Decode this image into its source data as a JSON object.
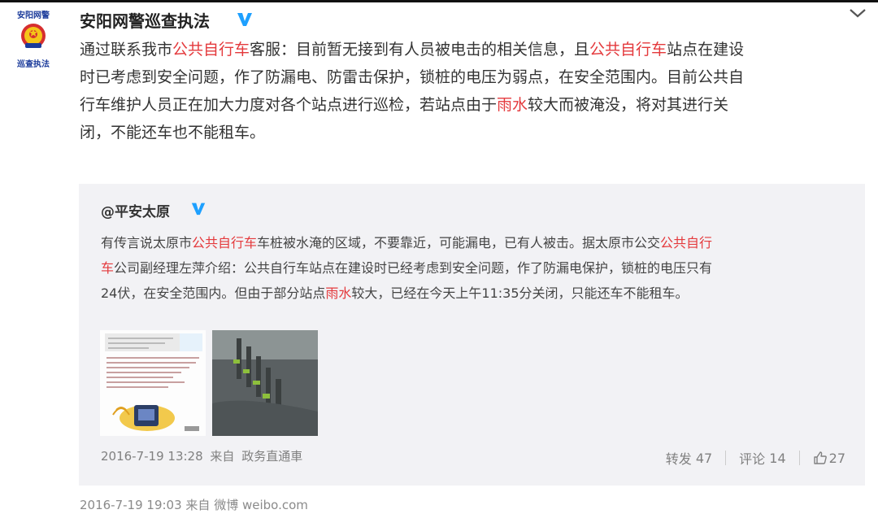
{
  "poster": {
    "avatar_top_text": "安阳网警",
    "avatar_bottom_text": "巡查执法",
    "name": "安阳网警巡查执法"
  },
  "post": {
    "lines": [
      [
        "通过联系我市",
        "公共自行车",
        "客服：目前暂无接到有人员被电击的相关信息，且",
        "公共自行车",
        "站点在建设"
      ],
      [
        "时已考虑到安全问题，作了防漏电、防雷击保护，锁桩的电压为弱点，在安全范围内。目前公共自"
      ],
      [
        "行车维护人员正在加大力度对各个站点进行巡检，若站点由于",
        "雨水",
        "较大而被淹没，将对其进行关"
      ],
      [
        "闭，不能还车也不能租车。"
      ]
    ],
    "meta": {
      "time": "2016-7-19 19:03",
      "from": "来自",
      "source": "微博 weibo.com"
    }
  },
  "repost": {
    "author": "@平安太原",
    "lines": [
      [
        "有传言说太原市",
        "公共自行车",
        "车桩被水淹的区域，不要靠近，可能漏电，已有人被击。据太原市公交",
        "公共自行"
      ],
      [
        "车",
        "公司副经理左萍介绍：公共自行车站点在建设时已经考虑到安全问题，作了防漏电保护，锁桩的电压只有"
      ],
      [
        "24伏，在安全范围内。但由于部分站点",
        "雨水",
        "较大，已经在今天上午11:35分关闭，只能还车不能租车。"
      ]
    ],
    "meta": {
      "time": "2016-7-19 13:28",
      "from": "来自",
      "source": "政务直通車"
    },
    "actions": {
      "forward_label": "转发",
      "forward_count": "47",
      "comment_label": "评论",
      "comment_count": "14",
      "like_count": "27"
    }
  },
  "colors": {
    "keyword": "#e4393c",
    "verified": "#1ea0ff",
    "repost_bg": "#f2f2f5"
  },
  "icons": {
    "verified": "verified-v-icon",
    "menu": "chevron-down-icon",
    "like": "thumbs-up-icon"
  }
}
